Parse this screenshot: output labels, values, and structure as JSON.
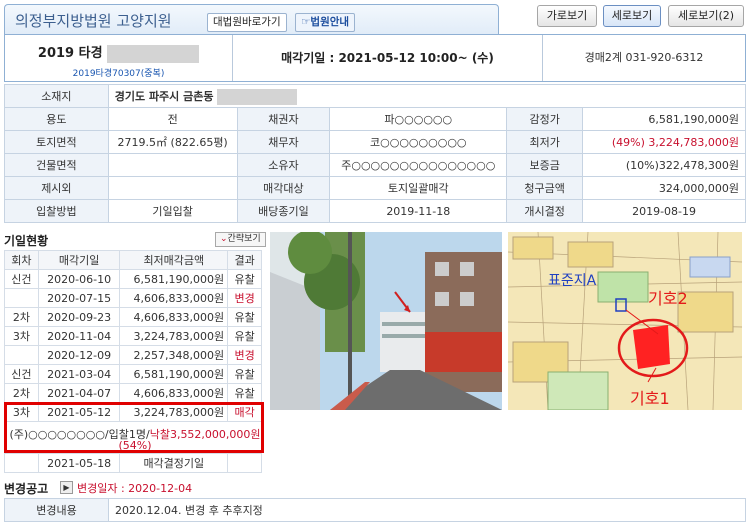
{
  "header": {
    "court_name": "의정부지방법원 고양지원",
    "court_link": "대법원바로가기",
    "court_guide": "법원안내",
    "view_buttons": [
      "가로보기",
      "세로보기",
      "세로보기(2)"
    ]
  },
  "case": {
    "number": "2019 타경",
    "sub": "2019타경70307(중복)",
    "sale_date": "매각기일 : 2021-05-12 10:00~ (수)",
    "department": "경매2계 031-920-6312"
  },
  "info": {
    "location_label": "소재지",
    "location_value": "경기도 파주시 금촌동",
    "rows": [
      [
        "용도",
        "전",
        "채권자",
        "파○○○○○○",
        "감정가",
        "6,581,190,000원"
      ],
      [
        "토지면적",
        "2719.5㎡ (822.65평)",
        "채무자",
        "코○○○○○○○○○",
        "최저가",
        "(49%) 3,224,783,000원"
      ],
      [
        "건물면적",
        "",
        "소유자",
        "주○○○○○○○○○○○○○○○",
        "보증금",
        "(10%)322,478,300원"
      ],
      [
        "제시외",
        "",
        "매각대상",
        "토지일괄매각",
        "청구금액",
        "324,000,000원"
      ],
      [
        "입찰방법",
        "기일입찰",
        "배당종기일",
        "2019-11-18",
        "개시결정",
        "2019-08-19"
      ]
    ]
  },
  "history": {
    "title": "기일현황",
    "brief_label": "간략보기",
    "headers": [
      "회차",
      "매각기일",
      "최저매각금액",
      "결과"
    ],
    "rows": [
      [
        "신건",
        "2020-06-10",
        "6,581,190,000원",
        "유찰"
      ],
      [
        "",
        "2020-07-15",
        "4,606,833,000원",
        "변경"
      ],
      [
        "2차",
        "2020-09-23",
        "4,606,833,000원",
        "유찰"
      ],
      [
        "3차",
        "2020-11-04",
        "3,224,783,000원",
        "유찰"
      ],
      [
        "",
        "2020-12-09",
        "2,257,348,000원",
        "변경"
      ],
      [
        "신건",
        "2021-03-04",
        "6,581,190,000원",
        "유찰"
      ],
      [
        "2차",
        "2021-04-07",
        "4,606,833,000원",
        "유찰"
      ],
      [
        "3차",
        "2021-05-12",
        "3,224,783,000원",
        "매각"
      ]
    ],
    "sale_detail_buyer": "(주)○○○○○○○○/입찰1명/",
    "sale_detail_price": "낙찰3,552,000,000원",
    "sale_detail_pct": "(54%)",
    "last_row": [
      "",
      "2021-05-18",
      "매각결정기일",
      ""
    ]
  },
  "map": {
    "label_a": "표준지A",
    "label_2": "기호2",
    "label_1": "기호1"
  },
  "notice": {
    "title": "변경공고",
    "date": "변경일자 : 2020-12-04",
    "content_label": "변경내용",
    "content_value": "2020.12.04. 변경 후 추후지정"
  },
  "colors": {
    "accent": "#3c5f8f",
    "alert": "#c8102e",
    "highlight_border": "#e00000"
  }
}
